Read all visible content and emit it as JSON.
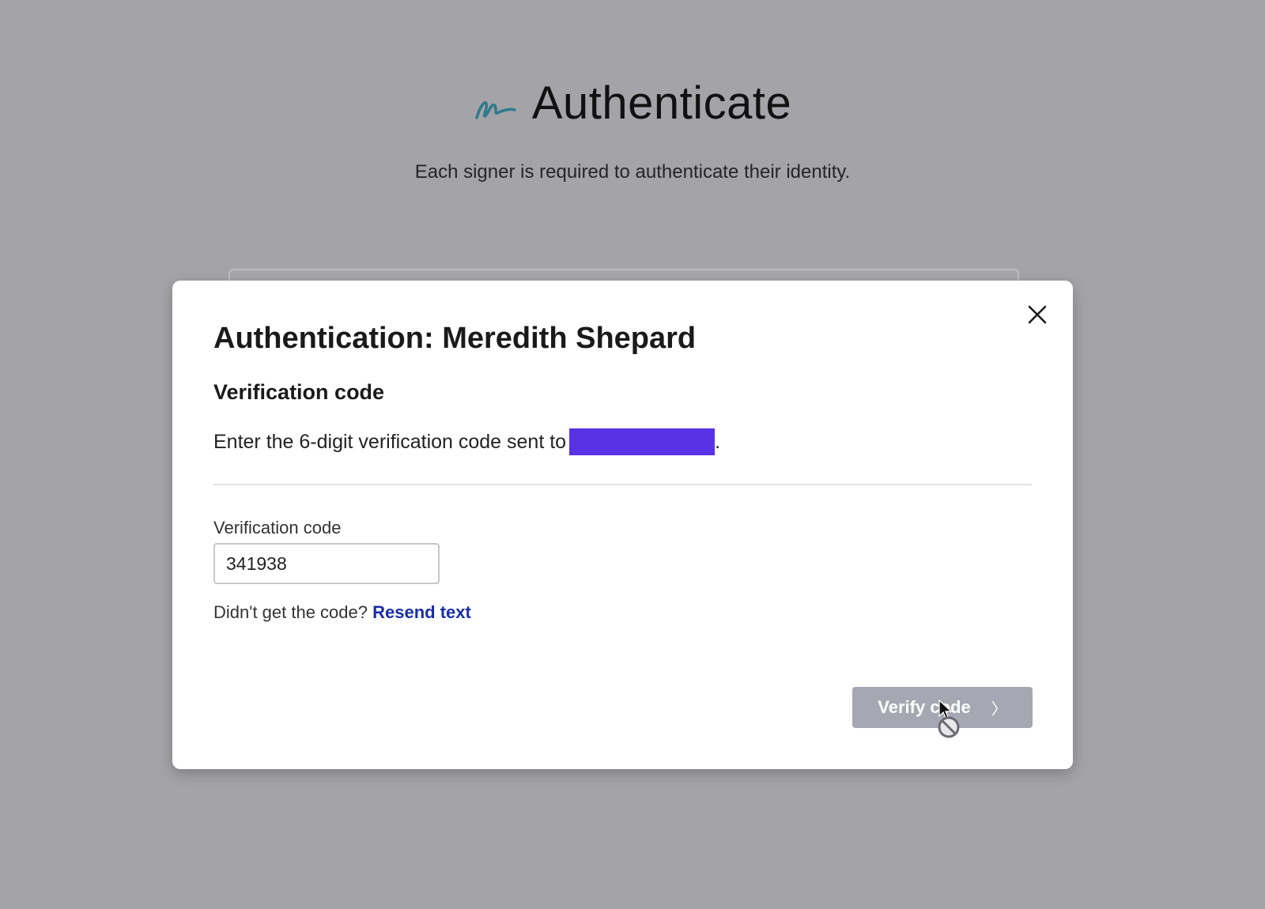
{
  "header": {
    "logo_icon": "signature-icon",
    "title": "Authenticate",
    "subtitle": "Each signer is required to authenticate their identity."
  },
  "modal": {
    "title": "Authentication: Meredith Shepard",
    "section_title": "Verification code",
    "instructions_text": "Enter the 6-digit verification code sent to",
    "instructions_end": ".",
    "redacted_color": "#5a32e6",
    "field_label": "Verification code",
    "code_value": "341938",
    "resend_prompt": "Didn't get the code?",
    "resend_link": "Resend text",
    "verify_button_label": "Verify code",
    "close_icon": "close-icon",
    "chevron_icon": "chevron-right-icon"
  },
  "colors": {
    "backdrop": "#a3a3a8",
    "logo": "#2e7a8a",
    "link": "#1a2ea8",
    "button_disabled": "#a5a8b2"
  }
}
